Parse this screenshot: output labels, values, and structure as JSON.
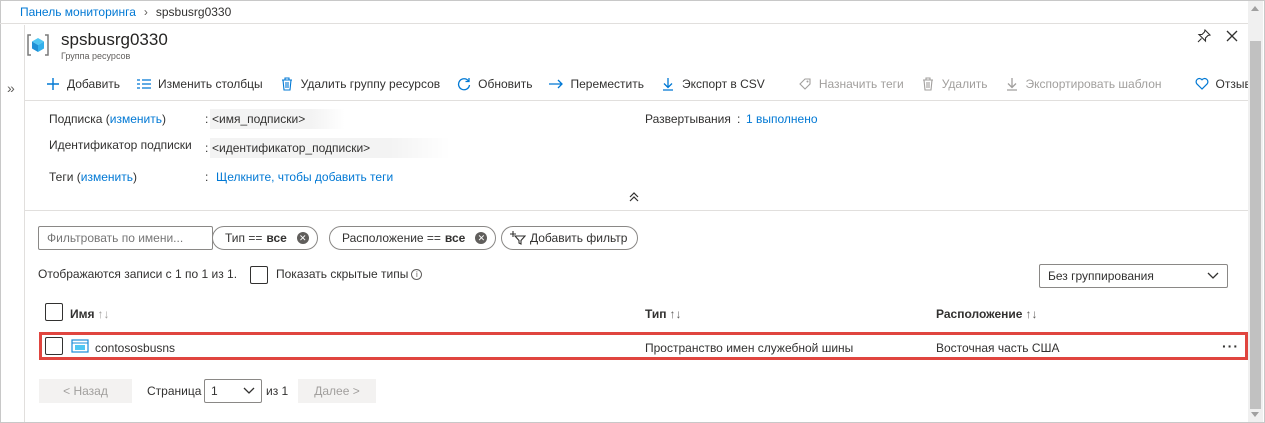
{
  "breadcrumb": {
    "home": "Панель мониторинга",
    "current": "spsbusrg0330"
  },
  "header": {
    "title": "spsbusrg0330",
    "subtitle": "Группа ресурсов"
  },
  "toolbar": {
    "add": "Добавить",
    "edit_columns": "Изменить столбцы",
    "delete_rg": "Удалить группу ресурсов",
    "refresh": "Обновить",
    "move": "Переместить",
    "export_csv": "Экспорт в CSV",
    "assign_tags": "Назначить теги",
    "delete": "Удалить",
    "export_template": "Экспортировать шаблон",
    "feedback": "Отзывы"
  },
  "essentials": {
    "subscription_label": "Подписка (",
    "subscription_change": "изменить",
    "subscription_close": ")",
    "subscription_value": "<имя_подписки>",
    "subscription_id_label": "Идентификатор подписки",
    "subscription_id_value": "<идентификатор_подписки>",
    "tags_label": "Теги (",
    "tags_change": "изменить",
    "tags_close": ")",
    "tags_value": "Щелкните, чтобы добавить теги",
    "deployments_label": "Развертывания",
    "deployments_value": "1 выполнено"
  },
  "filters": {
    "name_placeholder": "Фильтровать по имени...",
    "type_label": "Тип ==",
    "type_value": "все",
    "location_label": "Расположение ==",
    "location_value": "все",
    "add_filter": "Добавить фильтр"
  },
  "list": {
    "showing_text": "Отображаются записи с 1 по 1 из 1.",
    "show_hidden": "Показать скрытые типы",
    "grouping": "Без группирования",
    "columns": {
      "name": "Имя",
      "type": "Тип",
      "location": "Расположение"
    },
    "rows": [
      {
        "name": "contososbusns",
        "type": "Пространство имен служебной шины",
        "location": "Восточная часть США"
      }
    ]
  },
  "pager": {
    "prev": "< Назад",
    "page_label": "Страница",
    "page": "1",
    "of": "из 1",
    "next": "Далее >"
  },
  "colors": {
    "accent": "#0078d4",
    "highlight": "#e0453f",
    "text": "#323130"
  }
}
